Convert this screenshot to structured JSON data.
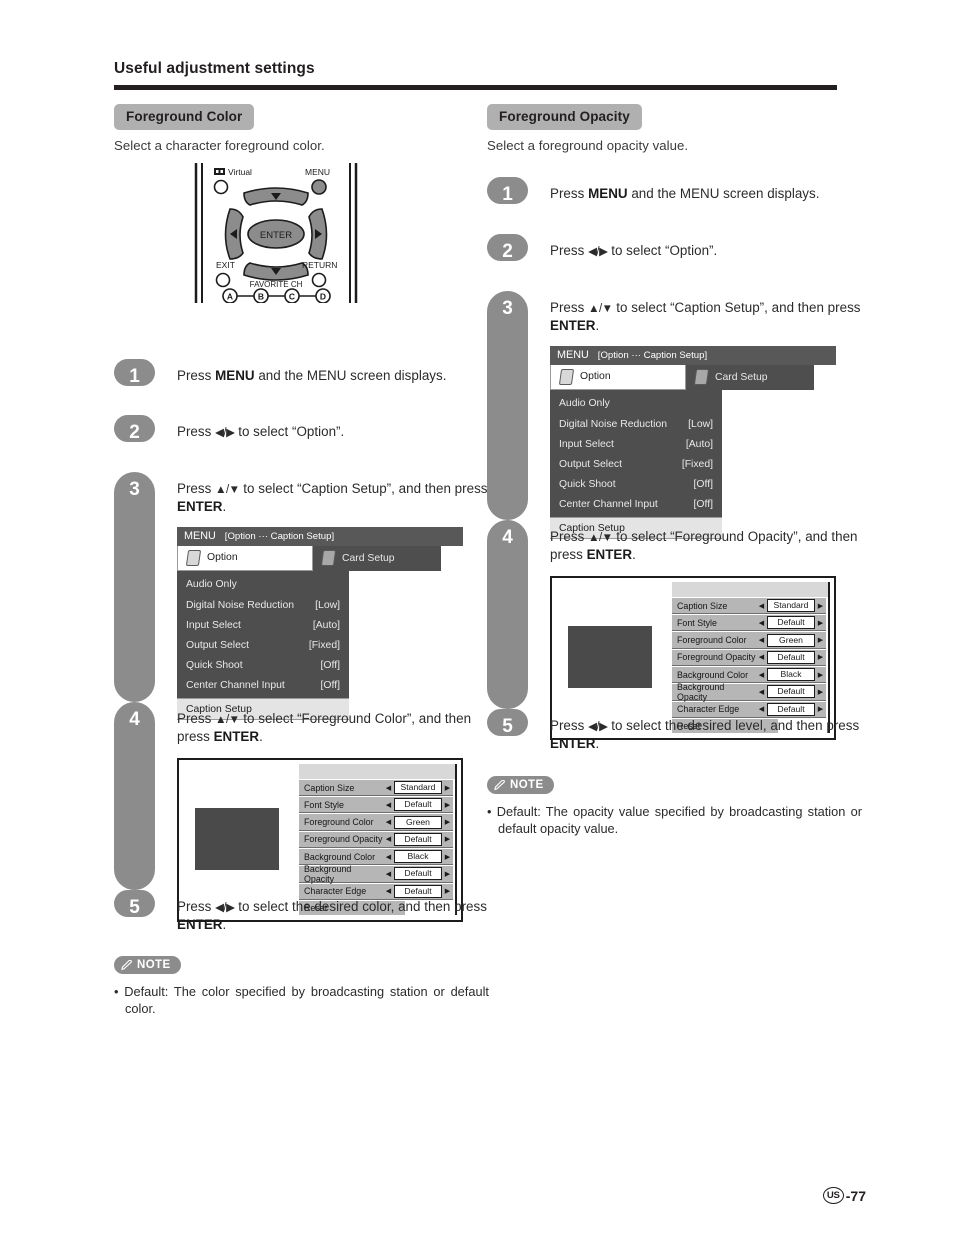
{
  "page": {
    "title": "Useful adjustment settings",
    "footer_region": "US",
    "footer_page": "-77"
  },
  "left": {
    "heading": "Foreground Color",
    "description": "Select a character foreground color.",
    "steps": [
      {
        "num": "1",
        "text_pre": "Press ",
        "bold1": "MENU",
        "text_mid": " and the MENU screen displays.",
        "bold2": "",
        "text_post": ""
      },
      {
        "num": "2",
        "text_pre": "Press ",
        "arrows": "◀/▶",
        "text_mid": " to select “Option”."
      },
      {
        "num": "3",
        "text_pre": "Press ",
        "arrows": "▲/▼",
        "text_mid": " to select “Caption Setup”, and then press ",
        "bold2": "ENTER",
        "text_post": "."
      },
      {
        "num": "4",
        "text_pre": "Press ",
        "arrows": "▲/▼",
        "text_mid": " to select “Foreground Color”, and then press ",
        "bold2": "ENTER",
        "text_post": "."
      },
      {
        "num": "5",
        "text_pre": "Press ",
        "arrows": "◀/▶",
        "text_mid": " to select the desired color, and then press ",
        "bold2": "ENTER",
        "text_post": "."
      }
    ],
    "note": {
      "label": "NOTE",
      "bullet": "• Default: The color specified by broadcasting station or default color."
    }
  },
  "right": {
    "heading": "Foreground Opacity",
    "description": "Select a foreground opacity value.",
    "steps": [
      {
        "num": "1",
        "text_pre": "Press ",
        "bold1": "MENU",
        "text_mid": " and the MENU screen displays."
      },
      {
        "num": "2",
        "text_pre": "Press ",
        "arrows": "◀/▶",
        "text_mid": " to select “Option”."
      },
      {
        "num": "3",
        "text_pre": "Press ",
        "arrows": "▲/▼",
        "text_mid": " to select “Caption Setup”, and then press ",
        "bold2": "ENTER",
        "text_post": "."
      },
      {
        "num": "4",
        "text_pre": "Press ",
        "arrows": "▲/▼",
        "text_mid": " to select “Foreground Opacity”, and then press ",
        "bold2": "ENTER",
        "text_post": "."
      },
      {
        "num": "5",
        "text_pre": "Press ",
        "arrows": "◀/▶",
        "text_mid": " to select the desired level, and then press ",
        "bold2": "ENTER",
        "text_post": "."
      }
    ],
    "note": {
      "label": "NOTE",
      "bullet": "• Default: The opacity value specified by broadcasting station or default opacity value."
    }
  },
  "remote": {
    "virtual_label": "Virtual",
    "menu_label": "MENU",
    "enter_label": "ENTER",
    "exit_label": "EXIT",
    "return_label": "RETURN",
    "favorite_label": "FAVORITE CH",
    "fav_a": "A",
    "fav_b": "B",
    "fav_c": "C",
    "fav_d": "D"
  },
  "osd_menu": {
    "title": "MENU",
    "breadcrumb": "[Option ··· Caption Setup]",
    "tabs": [
      {
        "label": "Option",
        "active": true
      },
      {
        "label": "Card Setup",
        "active": false
      }
    ],
    "rows": [
      {
        "label": "Audio Only",
        "value": "",
        "selected": false
      },
      {
        "label": "Digital Noise Reduction",
        "value": "[Low]",
        "selected": false
      },
      {
        "label": "Input Select",
        "value": "[Auto]",
        "selected": false
      },
      {
        "label": "Output Select",
        "value": "[Fixed]",
        "selected": false
      },
      {
        "label": "Quick Shoot",
        "value": "[Off]",
        "selected": false
      },
      {
        "label": "Center Channel Input",
        "value": "[Off]",
        "selected": false
      },
      {
        "label": "Caption Setup",
        "value": "",
        "selected": true
      }
    ]
  },
  "osd_caption": {
    "rows": [
      {
        "label": "Caption Size",
        "value": "Standard"
      },
      {
        "label": "Font Style",
        "value": "Default"
      },
      {
        "label": "Foreground Color",
        "value": "Green"
      },
      {
        "label": "Foreground Opacity",
        "value": "Default"
      },
      {
        "label": "Background Color",
        "value": "Black"
      },
      {
        "label": "Background Opacity",
        "value": "Default"
      },
      {
        "label": "Character Edge",
        "value": "Default"
      }
    ],
    "reset_label": "Reset",
    "left_arrow": "◀",
    "right_arrow": "▶"
  },
  "colors": {
    "rule": "#231f20",
    "badge_gray": "#b0b0b0",
    "step_gray": "#8c8c8c",
    "osd_dark": "#4e4e4e",
    "osd_titlebar": "#585858",
    "osd_selected": "#e4e4e4",
    "osd_row_gray": "#b6b6b6"
  }
}
